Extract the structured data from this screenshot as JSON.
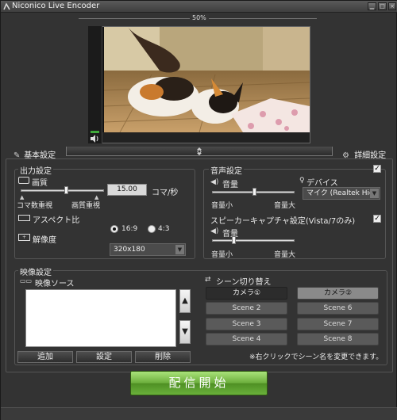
{
  "window": {
    "title": "Niconico Live Encoder"
  },
  "preview": {
    "zoom_label": "50%"
  },
  "tabs": {
    "basic": "基本設定",
    "advanced": "詳細設定"
  },
  "output": {
    "title": "出力設定",
    "quality_label": "画質",
    "fps_value": "15.00",
    "fps_unit": "コマ/秒",
    "fps_priority": "コマ数重視",
    "quality_priority": "画質重視",
    "quality_slider": 0.55,
    "aspect_label": "アスペクト比",
    "aspect_options": [
      "16:9",
      "4:3"
    ],
    "aspect_selected": "16:9",
    "resolution_label": "解像度",
    "resolution_value": "320x180"
  },
  "audio": {
    "title": "音声設定",
    "checked": true,
    "volume_label": "音量",
    "volume_min": "音量小",
    "volume_max": "音量大",
    "volume_level": 0.52,
    "device_label": "デバイス",
    "device_value": "マイク (Realtek Hig",
    "speaker_title": "スピーカーキャプチャ設定(Vista/7のみ)",
    "speaker_checked": true,
    "speaker_volume_label": "音量",
    "speaker_volume_min": "音量小",
    "speaker_volume_max": "音量大",
    "speaker_volume_level": 0.25
  },
  "video": {
    "title": "映像設定",
    "source_label": "映像ソース",
    "add": "追加",
    "settings": "設定",
    "delete": "削除"
  },
  "scenes": {
    "title": "シーン切り替え",
    "items": [
      "カメラ①",
      "カメラ②",
      "Scene 2",
      "Scene 6",
      "Scene 3",
      "Scene 7",
      "Scene 4",
      "Scene 8"
    ],
    "hint": "※右クリックでシーン名を変更できます。"
  },
  "golive": {
    "label": "配信開始"
  },
  "colors": {
    "accent_green": "#6cae3c",
    "background": "#353535"
  }
}
